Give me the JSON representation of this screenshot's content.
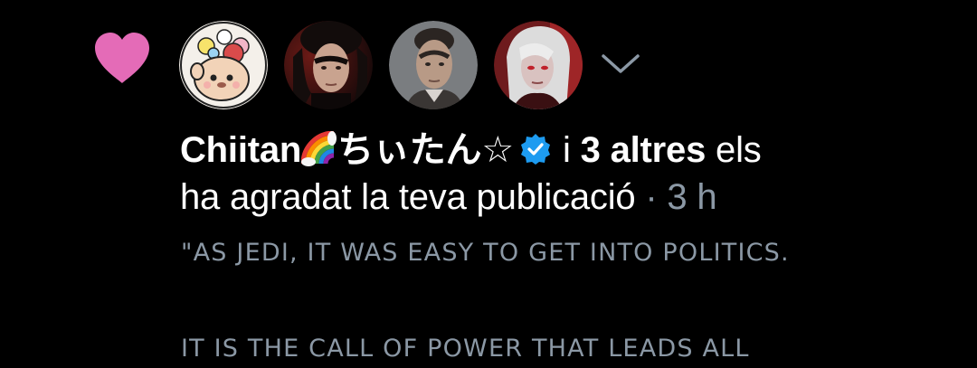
{
  "notification": {
    "actor_name": "Chiitan",
    "actor_name_suffix": "ちぃたん☆",
    "connector": "i",
    "others_count_text": "3 altres",
    "action_text_1": "els",
    "action_text_2": "ha agradat la teva publicació",
    "separator": "·",
    "timestamp": "3 h"
  },
  "post_preview": {
    "line_1": "\"AS JEDI, IT WAS EASY TO GET INTO POLITICS.",
    "line_2": "IT IS THE CALL OF POWER THAT LEADS ALL"
  },
  "icons": {
    "notification_type": "heart-icon",
    "expand": "chevron-down-icon",
    "verified": "verified-badge-icon",
    "emoji": "rainbow-emoji"
  },
  "colors": {
    "background": "#000000",
    "heart": "#e46bb7",
    "verified": "#1d9bf0",
    "text_primary": "#ffffff",
    "text_secondary": "#8b98a5"
  }
}
